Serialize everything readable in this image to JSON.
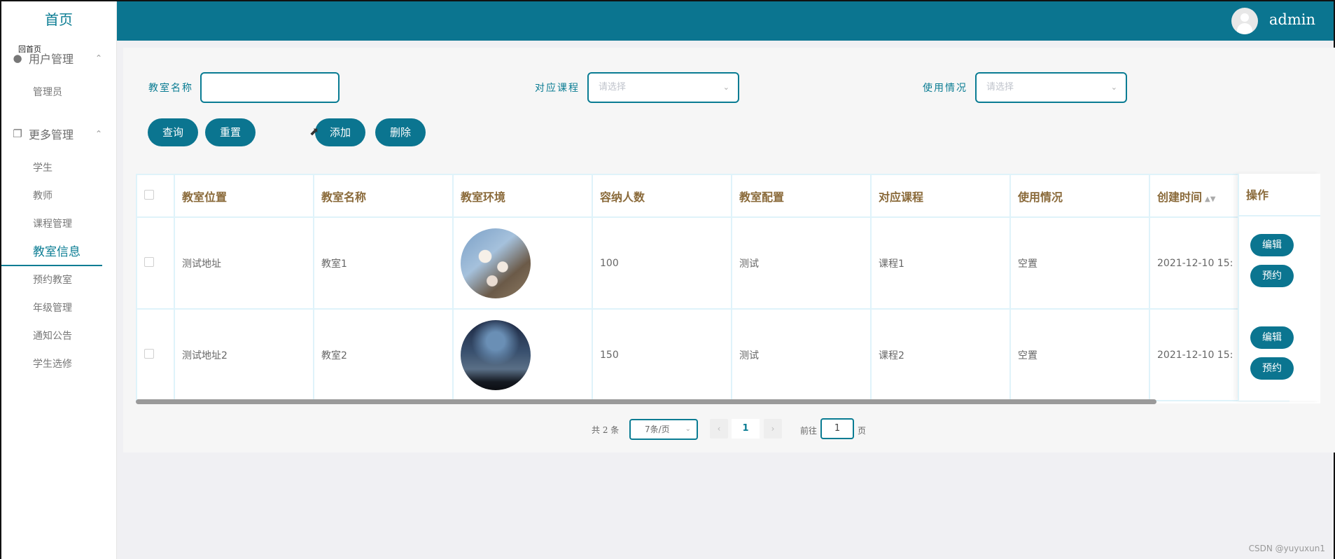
{
  "sidebar": {
    "home": "首页",
    "overlay_text": "回首页",
    "groups": [
      {
        "label": "用户管理",
        "items": [
          "管理员"
        ]
      },
      {
        "label": "更多管理",
        "items": [
          "学生",
          "教师",
          "课程管理",
          "教室信息",
          "预约教室",
          "年级管理",
          "通知公告",
          "学生选修"
        ]
      }
    ],
    "active_item": "教室信息"
  },
  "header": {
    "username": "admin"
  },
  "filters": {
    "name_label": "教室名称",
    "name_value": "",
    "course_label": "对应课程",
    "course_placeholder": "请选择",
    "usage_label": "使用情况",
    "usage_placeholder": "请选择"
  },
  "actions": {
    "query": "查询",
    "reset": "重置",
    "add": "添加",
    "delete": "删除"
  },
  "table": {
    "columns": [
      "教室位置",
      "教室名称",
      "教室环境",
      "容纳人数",
      "教室配置",
      "对应课程",
      "使用情况",
      "创建时间",
      "操作"
    ],
    "rows": [
      {
        "location": "测试地址",
        "name": "教室1",
        "capacity": "100",
        "config": "测试",
        "course": "课程1",
        "usage": "空置",
        "created": "2021-12-10 15:"
      },
      {
        "location": "测试地址2",
        "name": "教室2",
        "capacity": "150",
        "config": "测试",
        "course": "课程2",
        "usage": "空置",
        "created": "2021-12-10 15:"
      }
    ],
    "edit_label": "编辑",
    "book_label": "预约"
  },
  "pagination": {
    "total": "共 2 条",
    "page_size": "7条/页",
    "current_page": "1",
    "goto_label": "前往",
    "goto_value": "1",
    "page_unit": "页",
    "prev": "‹",
    "next": "›"
  },
  "watermark": "CSDN @yuyuxun1"
}
